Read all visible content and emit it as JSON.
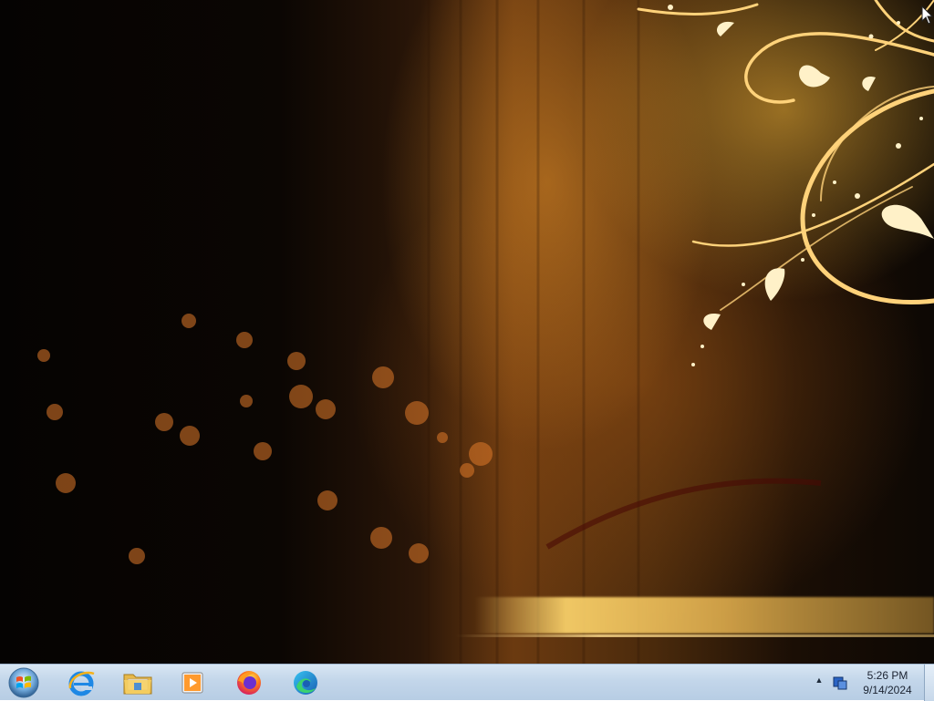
{
  "desktop": {
    "wallpaper": "golden-swirl-wallpaper"
  },
  "taskbar": {
    "start_button": {
      "icon": "windows-orb-icon"
    },
    "pinned": [
      {
        "name": "internet-explorer",
        "icon": "internet-explorer-icon"
      },
      {
        "name": "file-explorer",
        "icon": "folder-icon"
      },
      {
        "name": "media-player",
        "icon": "media-player-icon"
      },
      {
        "name": "firefox",
        "icon": "firefox-icon"
      },
      {
        "name": "edge",
        "icon": "edge-icon"
      }
    ],
    "tray": {
      "show_hidden_icon": "▲",
      "network_icon": "network-icon"
    },
    "clock": {
      "time": "5:26 PM",
      "date": "9/14/2024"
    }
  },
  "colors": {
    "taskbar_top": "#d8e6f3",
    "taskbar_bottom": "#b7cde4",
    "wallpaper_gold": "#f5c15a"
  }
}
